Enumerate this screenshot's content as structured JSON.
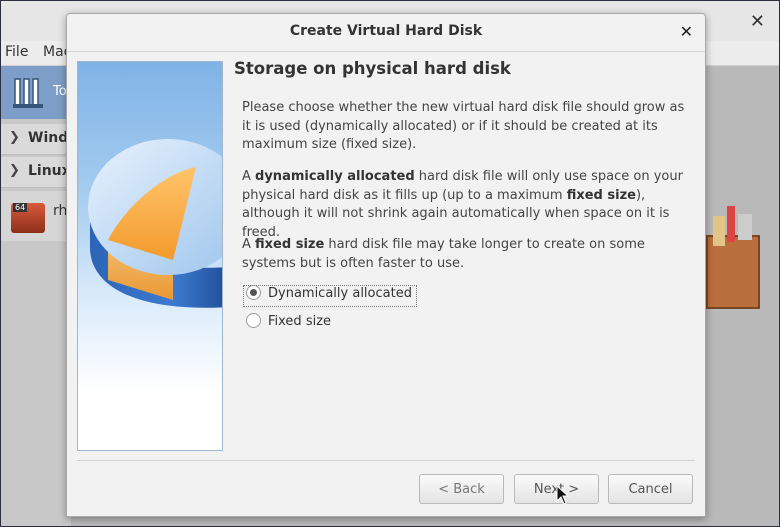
{
  "background_window": {
    "menu": [
      "File",
      "Mac"
    ],
    "tools_label": "To",
    "groups": [
      "Windo",
      "Linux"
    ],
    "vm_name": "rh",
    "vm_badge": "64"
  },
  "dialog": {
    "title": "Create Virtual Hard Disk",
    "heading": "Storage on physical hard disk",
    "intro": "Please choose whether the new virtual hard disk file should grow as it is used (dynamically allocated) or if it should be created at its maximum size (fixed size).",
    "dynamic_desc": {
      "pre": "A ",
      "bold1": "dynamically allocated",
      "mid": " hard disk file will only use space on your physical hard disk as it fills up (up to a maximum ",
      "bold2": "fixed size",
      "post": "), although it will not shrink again automatically when space on it is freed."
    },
    "fixed_desc": {
      "pre": "A ",
      "bold": "fixed size",
      "post": " hard disk file may take longer to create on some systems but is often faster to use."
    },
    "options": [
      {
        "label": "Dynamically allocated",
        "checked": true
      },
      {
        "label": "Fixed size",
        "checked": false
      }
    ],
    "buttons": {
      "back": "< Back",
      "next": "Next >",
      "cancel": "Cancel"
    }
  }
}
